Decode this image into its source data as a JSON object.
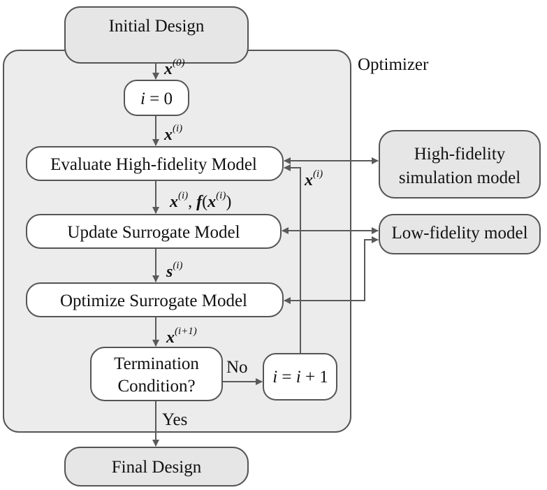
{
  "colors": {
    "terminal_fill": "#e6e6e6",
    "optimizer_fill": "#ececec",
    "process_fill": "#ffffff",
    "stroke": "#555555"
  },
  "nodes": {
    "initial": "Initial Design",
    "optimizer": "Optimizer",
    "init_i": {
      "var": "i",
      "rest": " = 0"
    },
    "evaluate": "Evaluate High-fidelity Model",
    "update": "Update Surrogate Model",
    "optimize": "Optimize Surrogate Model",
    "termination": [
      "Termination",
      "Condition?"
    ],
    "increment": {
      "v1": "i",
      "eq": " = ",
      "v2": "i",
      "rest": " + 1"
    },
    "final": "Final Design",
    "high_fidelity": [
      "High-fidelity",
      "simulation model"
    ],
    "low_fidelity": "Low-fidelity model"
  },
  "labels": {
    "x0": {
      "base": "x",
      "sup": "(0)"
    },
    "xi": {
      "base": "x",
      "sup": "(i)"
    },
    "xi_loop": {
      "base": "x",
      "sup": "(i)"
    },
    "xf": {
      "b1": "x",
      "s1": "(i)",
      "comma": ", ",
      "b2": "f",
      "p": "(",
      "b3": "x",
      "s3": "(i)",
      "close": ")"
    },
    "si": {
      "base": "s",
      "sup": "(i)"
    },
    "xi1": {
      "base": "x",
      "sup": "(i+1)"
    },
    "no": "No",
    "yes": "Yes"
  }
}
